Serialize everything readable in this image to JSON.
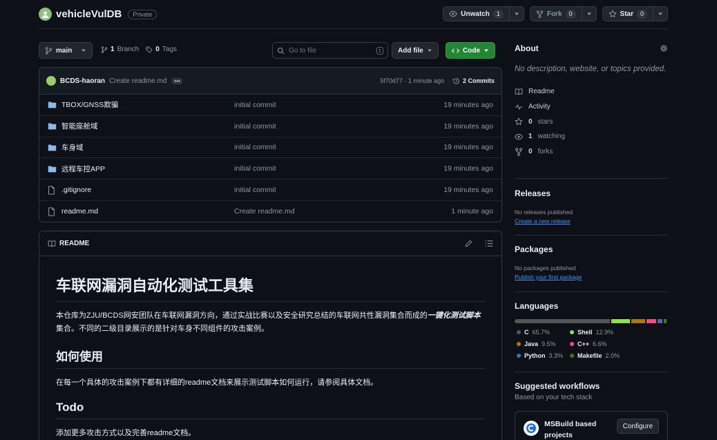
{
  "repo": {
    "name": "vehicleVulDB",
    "visibility": "Private"
  },
  "actions": {
    "unwatch_label": "Unwatch",
    "unwatch_count": "1",
    "fork_label": "Fork",
    "fork_count": "0",
    "star_label": "Star",
    "star_count": "0"
  },
  "toolbar": {
    "branch": "main",
    "branches_count": "1",
    "branches_label": "Branch",
    "tags_count": "0",
    "tags_label": "Tags",
    "search_placeholder": "Go to file",
    "search_kbd": "t",
    "add_file_label": "Add file",
    "code_label": "Code"
  },
  "commit": {
    "author": "BCDS-haoran",
    "message": "Create readme.md",
    "sha_time": "5f70d77 · 1 minute ago",
    "commits_label": "2 Commits"
  },
  "files": [
    {
      "type": "dir",
      "name": "TBOX/GNSS欺骗",
      "commit": "initial commit",
      "time": "19 minutes ago"
    },
    {
      "type": "dir",
      "name": "智能座舱域",
      "commit": "initial commit",
      "time": "19 minutes ago"
    },
    {
      "type": "dir",
      "name": "车身域",
      "commit": "initial commit",
      "time": "19 minutes ago"
    },
    {
      "type": "dir",
      "name": "远程车控APP",
      "commit": "initial commit",
      "time": "19 minutes ago"
    },
    {
      "type": "file",
      "name": ".gitignore",
      "commit": "initial commit",
      "time": "19 minutes ago"
    },
    {
      "type": "file",
      "name": "readme.md",
      "commit": "Create readme.md",
      "time": "1 minute ago"
    }
  ],
  "readme": {
    "tab_label": "README",
    "h1": "车联网漏洞自动化测试工具集",
    "p1_before": "本仓库为ZJU/BCDS网安团队在车联网漏洞方向，通过实战比赛以及安全研究总结的车联网共性漏洞集合而成的",
    "p1_em": "一键化测试脚本",
    "p1_after": "集合。不同的二级目录展示的是针对车身不同组件的攻击案例。",
    "h2_usage": "如何使用",
    "p_usage": "在每一个具体的攻击案例下都有详细的readme文档来展示测试脚本如何运行，请参阅具体文档。",
    "h2_todo": "Todo",
    "p_todo": "添加更多攻击方式以及完善readme文档。"
  },
  "about": {
    "title": "About",
    "description": "No description, website, or topics provided.",
    "items": [
      {
        "icon": "book-icon",
        "label": "Readme",
        "count": ""
      },
      {
        "icon": "pulse-icon",
        "label": "Activity",
        "count": ""
      },
      {
        "icon": "star-icon",
        "label": "stars",
        "count": "0"
      },
      {
        "icon": "eye-icon",
        "label": "watching",
        "count": "1"
      },
      {
        "icon": "fork-icon",
        "label": "forks",
        "count": "0"
      }
    ]
  },
  "releases": {
    "title": "Releases",
    "empty": "No releases published",
    "link": "Create a new release"
  },
  "packages": {
    "title": "Packages",
    "empty": "No packages published",
    "link": "Publish your first package"
  },
  "languages": {
    "title": "Languages",
    "items": [
      {
        "name": "C",
        "percent": "65.7%",
        "value": 65.7,
        "color": "#555555"
      },
      {
        "name": "Shell",
        "percent": "12.9%",
        "value": 12.9,
        "color": "#89e051"
      },
      {
        "name": "Java",
        "percent": "9.5%",
        "value": 9.5,
        "color": "#b07219"
      },
      {
        "name": "C++",
        "percent": "6.6%",
        "value": 6.6,
        "color": "#f34b7d"
      },
      {
        "name": "Python",
        "percent": "3.3%",
        "value": 3.3,
        "color": "#3572A5"
      },
      {
        "name": "Makefile",
        "percent": "2.0%",
        "value": 2.0,
        "color": "#427819"
      }
    ]
  },
  "workflows": {
    "title": "Suggested workflows",
    "subtitle": "Based on your tech stack",
    "card_title": "MSBuild based projects",
    "configure_label": "Configure"
  }
}
